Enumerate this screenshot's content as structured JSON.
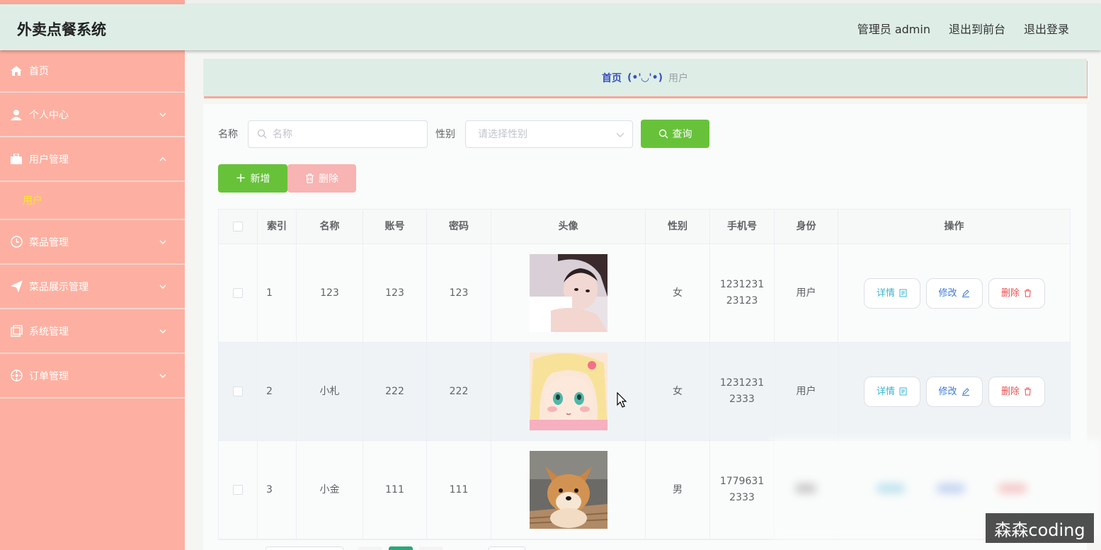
{
  "header": {
    "brand": "外卖点餐系统",
    "admin_label": "管理员 admin",
    "to_front": "退出到前台",
    "logout": "退出登录"
  },
  "sidebar": {
    "items": [
      {
        "label": "首页",
        "icon": "home-icon"
      },
      {
        "label": "个人中心",
        "icon": "user-icon"
      },
      {
        "label": "用户管理",
        "icon": "briefcase-icon",
        "expanded": true,
        "children": [
          "用户"
        ]
      },
      {
        "label": "菜品管理",
        "icon": "clock-icon"
      },
      {
        "label": "菜品展示管理",
        "icon": "send-icon"
      },
      {
        "label": "系统管理",
        "icon": "copy-icon"
      },
      {
        "label": "订单管理",
        "icon": "compass-icon"
      }
    ]
  },
  "breadcrumb": {
    "home": "首页",
    "separator": "(•'◡'•)",
    "current": "用户"
  },
  "search": {
    "name_label": "名称",
    "name_placeholder": "名称",
    "gender_label": "性别",
    "gender_placeholder": "请选择性别",
    "query_button": "查询"
  },
  "actions": {
    "add": "新增",
    "delete": "删除"
  },
  "table": {
    "columns": [
      "索引",
      "名称",
      "账号",
      "密码",
      "头像",
      "性别",
      "手机号",
      "身份",
      "操作"
    ],
    "rows": [
      {
        "index": "1",
        "name": "123",
        "account": "123",
        "password": "123",
        "avatar": "girl-photo",
        "gender": "女",
        "phone_l1": "1231231",
        "phone_l2": "23123",
        "role": "用户"
      },
      {
        "index": "2",
        "name": "小札",
        "account": "222",
        "password": "222",
        "avatar": "anime-girl-illustration",
        "gender": "女",
        "phone_l1": "1231231",
        "phone_l2": "2333",
        "role": "用户"
      },
      {
        "index": "3",
        "name": "小金",
        "account": "111",
        "password": "111",
        "avatar": "shiba-dog-photo",
        "gender": "男",
        "phone_l1": "1779631",
        "phone_l2": "2333",
        "role": ""
      }
    ],
    "op_detail": "详情",
    "op_edit": "修改",
    "op_delete": "删除"
  },
  "watermark": "森森coding",
  "colors": {
    "header_bg": "#deeee7",
    "sidebar_bg": "#fdb0a1",
    "submenu_active": "#ffe629",
    "primary_green": "#67c23a",
    "danger_light": "#f7b4b2",
    "detail_color": "#38b5d3",
    "edit_color": "#3a78d8",
    "delete_color": "#f04c4c"
  }
}
